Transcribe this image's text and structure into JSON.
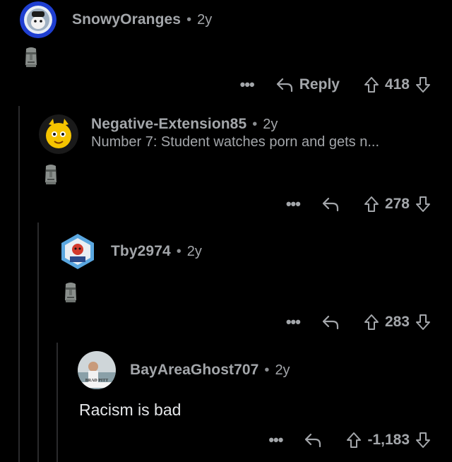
{
  "comments": [
    {
      "username": "SnowyOranges",
      "separator": "•",
      "age": "2y",
      "body_emoji": "moai-emoji",
      "more": "•••",
      "reply_label": "Reply",
      "score": "418"
    },
    {
      "username": "Negative-Extension85",
      "separator": "•",
      "age": "2y",
      "snippet": "Number 7: Student watches porn and gets n...",
      "body_emoji": "moai-emoji",
      "more": "•••",
      "score": "278"
    },
    {
      "username": "Tby2974",
      "separator": "•",
      "age": "2y",
      "body_emoji": "moai-emoji",
      "more": "•••",
      "score": "283"
    },
    {
      "username": "BayAreaGhost707",
      "separator": "•",
      "age": "2y",
      "avatar_caption": "BRAD PITT",
      "body": "Racism is bad",
      "more": "•••",
      "score": "-1,183"
    }
  ],
  "colors": {
    "background": "#000000",
    "meta_text": "#a3a6aa",
    "thread_line": "#2a2a2c"
  },
  "icons": [
    "upvote-icon",
    "downvote-icon",
    "reply-icon",
    "more-options-icon",
    "moai-emoji"
  ]
}
